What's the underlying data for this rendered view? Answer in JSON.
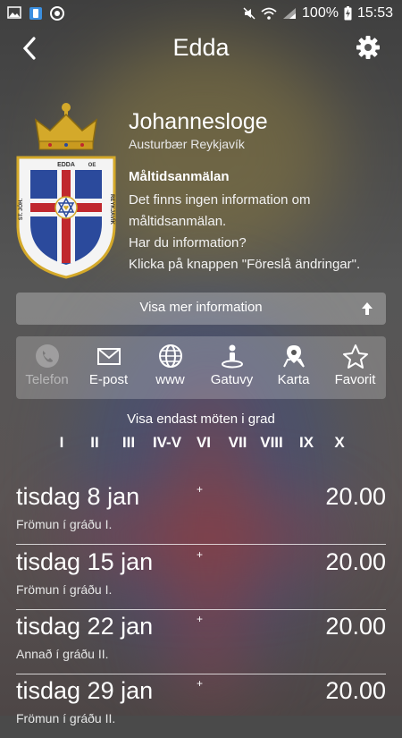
{
  "status": {
    "battery": "100%",
    "time": "15:53"
  },
  "header": {
    "title": "Edda"
  },
  "lodge": {
    "name": "Johannesloge",
    "subtitle": "Austurbær Reykjavík",
    "crest_text": [
      "EDDA",
      "REYKJAVÍK",
      "ST. JÓH.",
      "OE"
    ]
  },
  "meal": {
    "title": "Måltidsanmälan",
    "lines": [
      "Det finns ingen information om",
      "måltidsanmälan.",
      "Har du information?",
      "Klicka på knappen \"Föreslå ändringar\"."
    ]
  },
  "more_info": {
    "label": "Visa mer information"
  },
  "actions": [
    {
      "label": "Telefon",
      "icon": "phone-icon"
    },
    {
      "label": "E-post",
      "icon": "envelope-icon"
    },
    {
      "label": "www",
      "icon": "globe-icon"
    },
    {
      "label": "Gatuvy",
      "icon": "street-view-icon"
    },
    {
      "label": "Karta",
      "icon": "map-pin-icon"
    },
    {
      "label": "Favorit",
      "icon": "star-icon"
    }
  ],
  "grades": {
    "label": "Visa endast möten i grad",
    "items": [
      "I",
      "II",
      "III",
      "IV-V",
      "VI",
      "VII",
      "VIII",
      "IX",
      "X"
    ]
  },
  "meetings": [
    {
      "date": "tisdag 8 jan",
      "time": "20.00",
      "marker": "+",
      "description": "Frömun í gráðu I."
    },
    {
      "date": "tisdag 15 jan",
      "time": "20.00",
      "marker": "+",
      "description": "Frömun í gráðu I."
    },
    {
      "date": "tisdag 22 jan",
      "time": "20.00",
      "marker": "+",
      "description": "Annað í gráðu II."
    },
    {
      "date": "tisdag 29 jan",
      "time": "20.00",
      "marker": "+",
      "description": "Frömun í gráðu II."
    }
  ],
  "colors": {
    "shield_blue": "#2b4a9c",
    "cross_red": "#c0282e",
    "crown_gold": "#d4a92a"
  }
}
